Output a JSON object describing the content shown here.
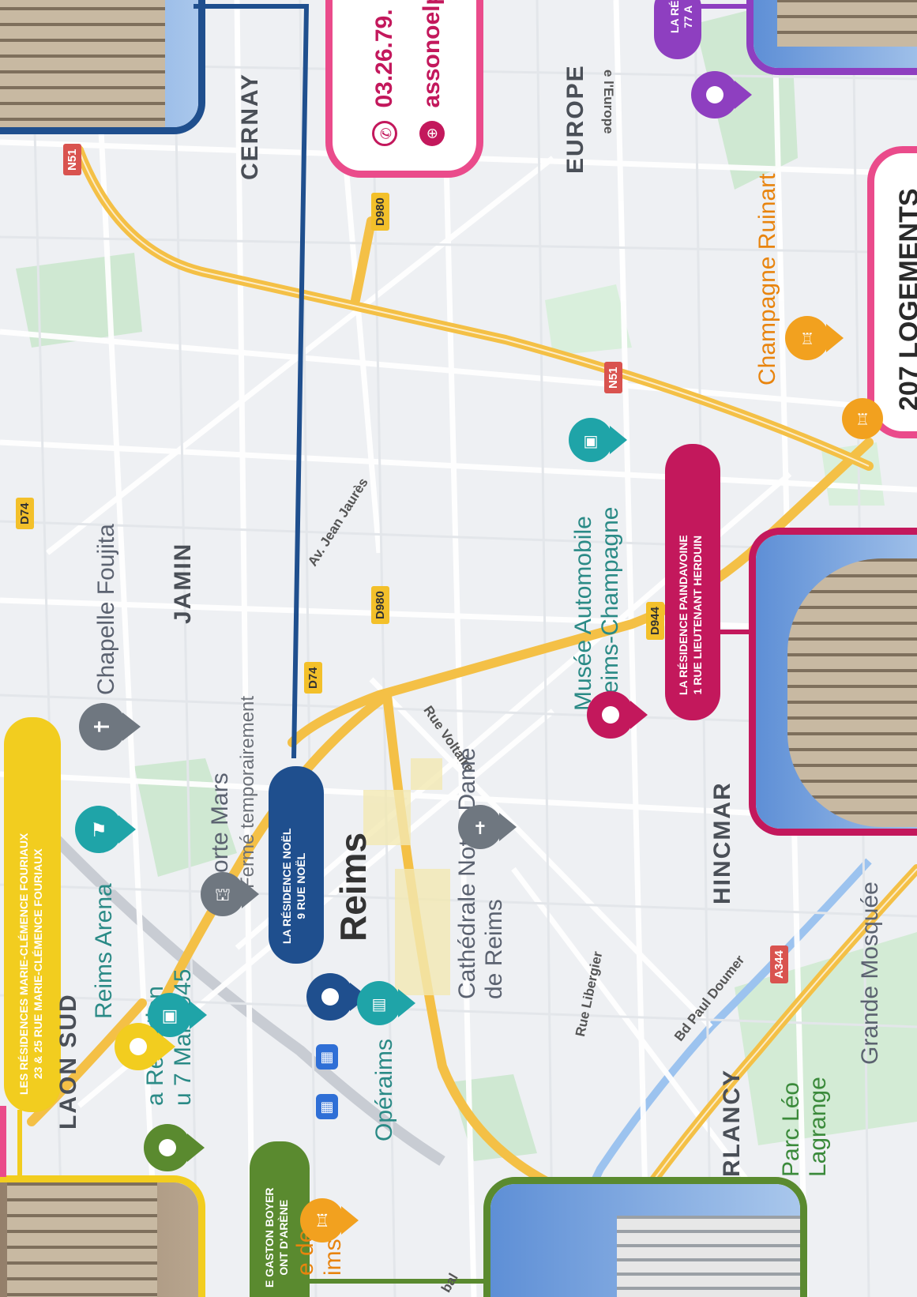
{
  "colors": {
    "blue": "#1f4f8e",
    "magenta": "#c3185c",
    "pink": "#ea4b8b",
    "yellow": "#f2cd1f",
    "green": "#5a8a2f",
    "purple": "#8e3fc0",
    "teal": "#1fa4a8",
    "road": "#f4c046"
  },
  "city": "Reims",
  "districts": [
    "CERNAY",
    "JAMIN",
    "EUROPE",
    "HINCMAR",
    "LAON SUD",
    "RLANCY"
  ],
  "streets": [
    "Av. Jean Jaurès",
    "Rue Voltaire",
    "Rue Libergier",
    "Bd Paul Doumer",
    "e l'Europe"
  ],
  "routes": [
    "N51",
    "D980",
    "D980",
    "D74",
    "D944",
    "N51",
    "A344",
    "D74"
  ],
  "pois": {
    "chapelle": "Chapelle Foujita",
    "porte_mars": "Porte Mars",
    "porte_mars_status": "Fermé temporairement",
    "arena": "Reims Arena",
    "cathedrale": "Cathédrale Notre-Dame de Reims",
    "operaims": "Opéraims",
    "musee_auto": "Musée Automobile Reims-Champagne",
    "ruinart": "Champagne Ruinart",
    "parc": "Parc Léo Lagrange",
    "mosquee": "Grande Mosquée",
    "reddition_1": "a Reddition",
    "reddition_2": "u 7 Mai 1945",
    "de_reims_1": "e de",
    "de_reims_2": "ims",
    "partial_street": "bal"
  },
  "labels": {
    "noel_title": "LA RÉSIDENCE NOËL",
    "noel_addr": "9 RUE NOËL",
    "fouriaux_title": "LES RÉSIDENCES MARIE-CLÉMENCE FOURIAUX",
    "fouriaux_addr": "23 & 25 RUE MARIE-CLÉMENCE FOURIAUX",
    "paindavoine_title": "LA RÉSIDENCE PAINDAVOINE",
    "paindavoine_addr": "1 RUE LIEUTENANT HERDUIN",
    "boyer_title": "E GASTON BOYER",
    "boyer_addr": "ONT D'ARÈNE",
    "top_right_title": "LA RÉ",
    "top_right_addr": "77 A",
    "logements": "207 LOGEMENTS"
  },
  "contact": {
    "phone": "03.26.79.",
    "web": "assonoelp"
  }
}
